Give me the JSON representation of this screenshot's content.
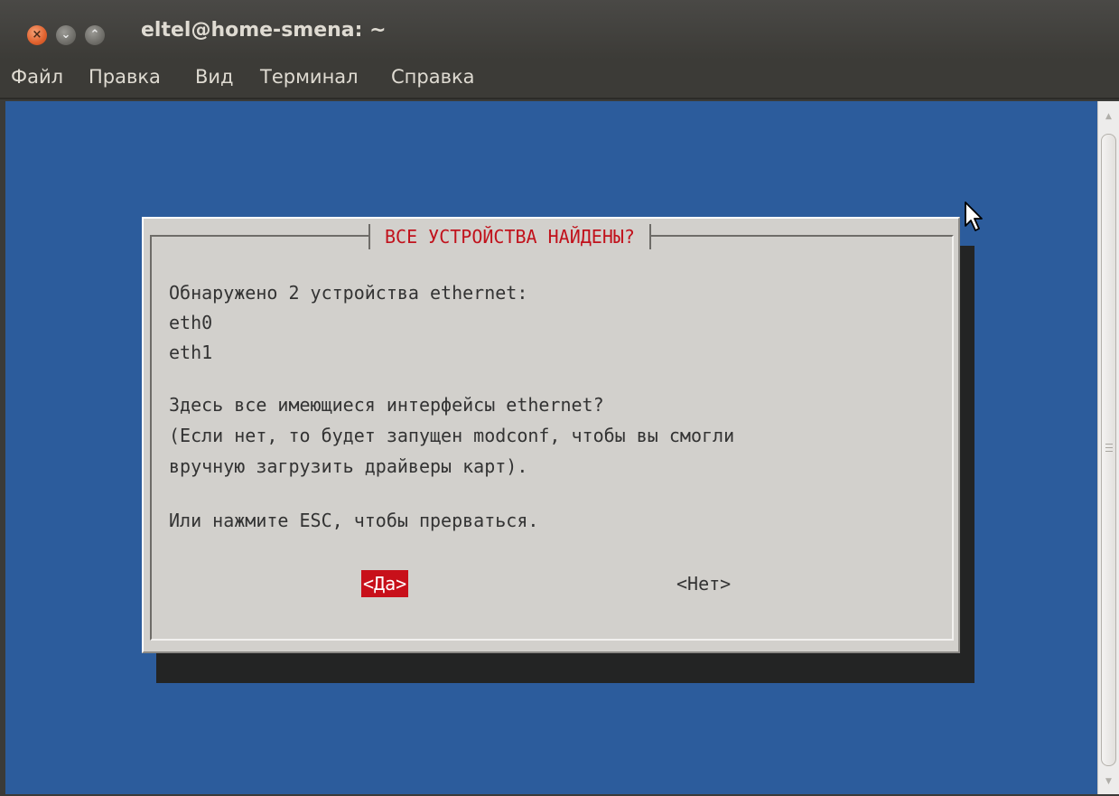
{
  "window": {
    "title": "eltel@home-smena: ~",
    "buttons": {
      "close_glyph": "×",
      "minimize_glyph": "⌄",
      "maximize_glyph": "⌃"
    }
  },
  "menu": {
    "items": [
      "Файл",
      "Правка",
      "Вид",
      "Терминал",
      "Справка"
    ]
  },
  "colors": {
    "terminal_bg": "#2c5c9c",
    "dialog_bg": "#d2d0cc",
    "title_red": "#c1121c",
    "selected_button_bg": "#c8101a"
  },
  "dialog": {
    "title": "ВСЕ УСТРОЙСТВА НАЙДЕНЫ?",
    "lines": [
      "Обнаружено 2 устройства ethernet:",
      "eth0",
      "eth1",
      "",
      "Здесь все имеющиеся интерфейсы ethernet?",
      "(Если нет, то будет запущен modconf, чтобы вы смогли",
      "вручную загрузить драйверы карт).",
      "",
      "Или нажмите ESC, чтобы прерваться."
    ],
    "yes_button": "<Да>",
    "no_button": "<Нет>"
  },
  "scrollbar": {
    "up_arrow": "▲",
    "down_arrow": "▼"
  }
}
